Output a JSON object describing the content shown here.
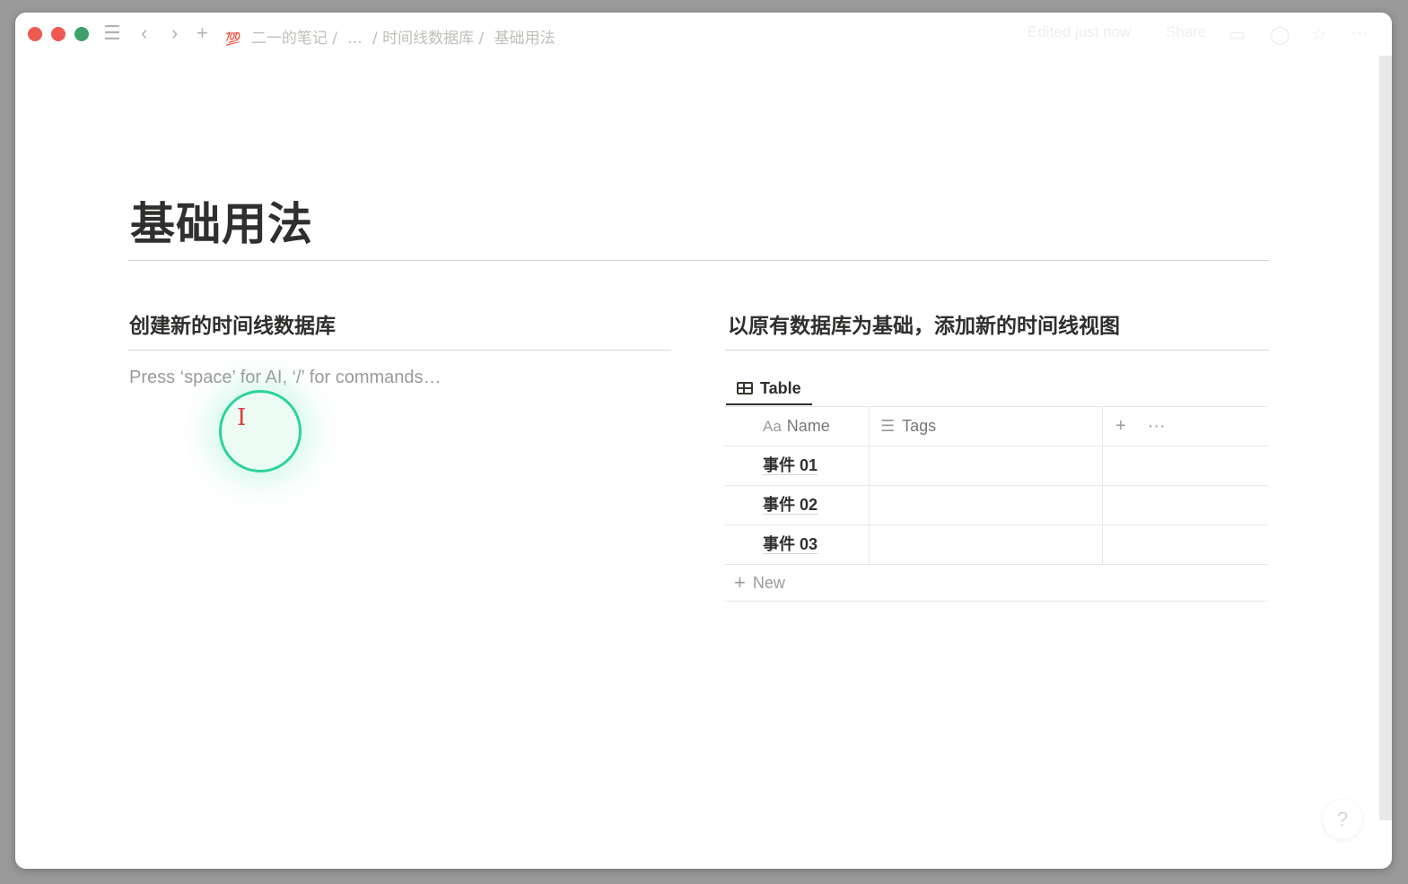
{
  "breadcrumb": {
    "emoji": "💯",
    "workspace": "二一的笔记 /",
    "ellipsis": "...",
    "parent": "/ 时间线数据库 /",
    "current": "基础用法"
  },
  "topbar_right": {
    "edited": "Edited just now",
    "share": "Share"
  },
  "page": {
    "title": "基础用法"
  },
  "left_column": {
    "heading": "创建新的时间线数据库",
    "placeholder": "Press ‘space’ for AI, ‘/’ for commands…"
  },
  "right_column": {
    "heading": "以原有数据库为基础，添加新的时间线视图",
    "view_tab": "Table",
    "columns": {
      "name_prefix": "Aa",
      "name": "Name",
      "tags": "Tags",
      "add": "+",
      "more": "···"
    },
    "rows": [
      {
        "name": "事件 01",
        "tags": ""
      },
      {
        "name": "事件 02",
        "tags": ""
      },
      {
        "name": "事件 03",
        "tags": ""
      }
    ],
    "new_label": "New"
  },
  "help": "?",
  "colors": {
    "accent_cursor": "#2ad39a",
    "close": "#ee5a52",
    "zoom": "#3fa06b"
  }
}
